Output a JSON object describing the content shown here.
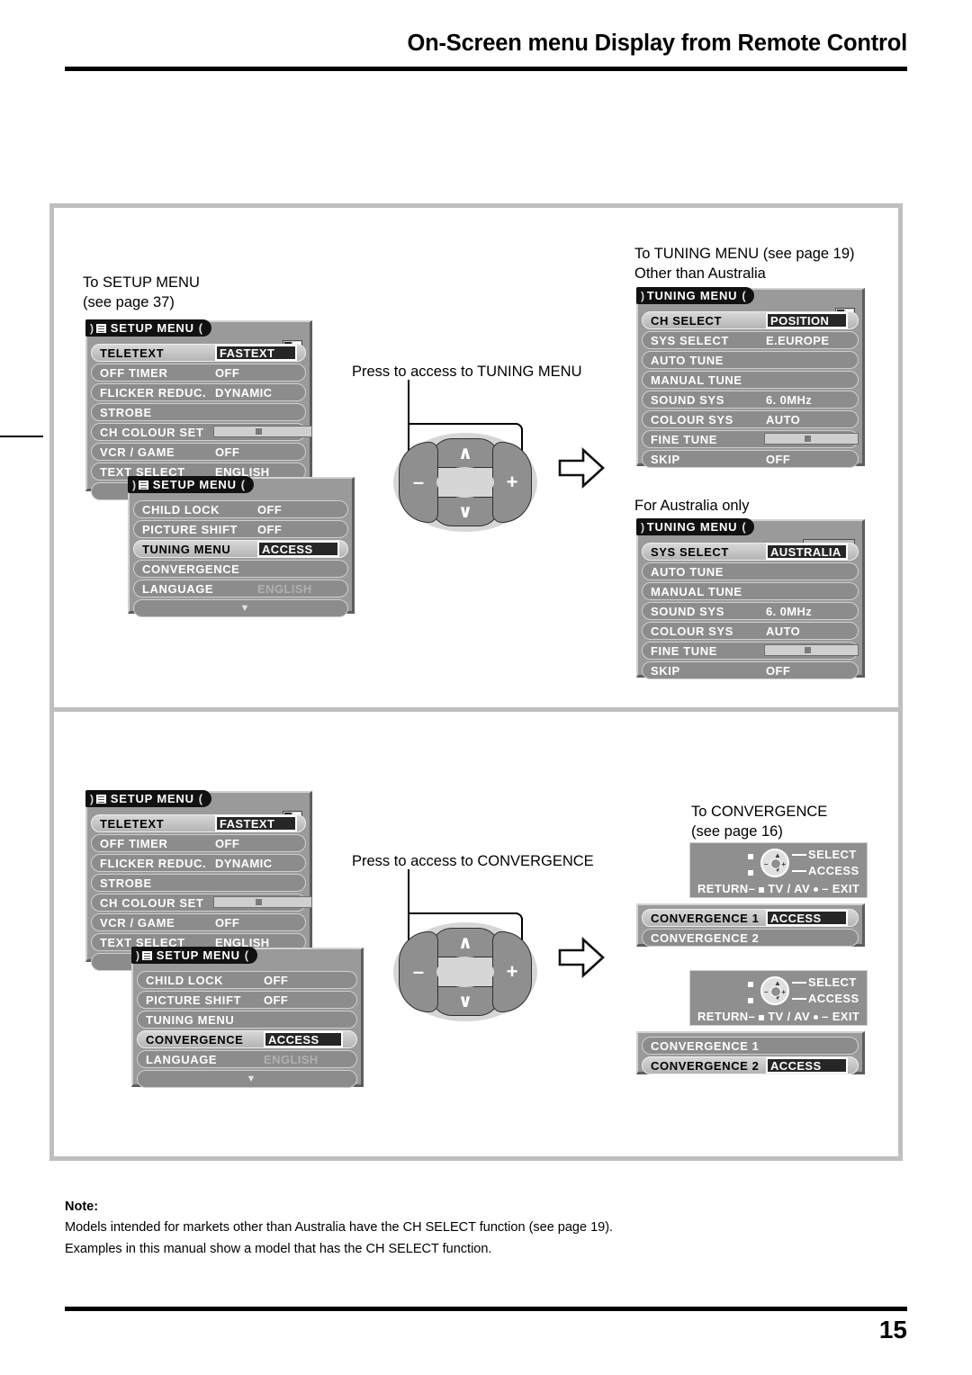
{
  "header": {
    "title": "On-Screen menu Display from Remote Control"
  },
  "footer": {
    "page_number": "15"
  },
  "note": {
    "label": "Note:",
    "line1": "Models intended for markets other than Australia have the CH SELECT function (see page 19).",
    "line2": "Examples in this manual show a model that has the CH SELECT function."
  },
  "captions": {
    "to_setup_menu": "To SETUP MENU\n(see page 37)",
    "press_tuning": "Press to access to TUNING MENU",
    "press_convergence": "Press to access to CONVERGENCE",
    "to_tuning_menu": "To TUNING MENU (see page 19)\nOther than Australia",
    "for_australia_only": "For Australia only",
    "to_convergence": "To CONVERGENCE\n(see page 16)"
  },
  "osd": {
    "setup_menu_title": "SETUP MENU",
    "tuning_menu_title": "TUNING MENU",
    "title_lead": ")",
    "title_tail": "(",
    "down_arrow": "▼"
  },
  "setup_page1": {
    "rows": [
      {
        "label": "TELETEXT",
        "value": "FASTEXT",
        "selected": true,
        "boxed": true
      },
      {
        "label": "OFF TIMER",
        "value": "OFF"
      },
      {
        "label": "FLICKER REDUC.",
        "value": "DYNAMIC"
      },
      {
        "label": "STROBE",
        "value": ""
      },
      {
        "label": "CH COLOUR SET",
        "value": "",
        "slider": true
      },
      {
        "label": "VCR / GAME",
        "value": "OFF"
      },
      {
        "label": "TEXT SELECT",
        "value": "ENGLISH"
      },
      {
        "label": "",
        "value": ""
      }
    ]
  },
  "setup_page2_tuning": {
    "rows": [
      {
        "label": "CHILD LOCK",
        "value": "OFF"
      },
      {
        "label": "PICTURE SHIFT",
        "value": "OFF"
      },
      {
        "label": "TUNING MENU",
        "value": "ACCESS",
        "selected": true,
        "boxed": true
      },
      {
        "label": "CONVERGENCE",
        "value": ""
      },
      {
        "label": "LANGUAGE",
        "value": "ENGLISH",
        "dim": true
      },
      {
        "label": "",
        "value": "",
        "arrow": true
      }
    ]
  },
  "setup_page2_convergence": {
    "rows": [
      {
        "label": "CHILD LOCK",
        "value": "OFF"
      },
      {
        "label": "PICTURE SHIFT",
        "value": "OFF"
      },
      {
        "label": "TUNING MENU",
        "value": ""
      },
      {
        "label": "CONVERGENCE",
        "value": "ACCESS",
        "selected": true,
        "boxed": true
      },
      {
        "label": "LANGUAGE",
        "value": "ENGLISH",
        "dim": true
      },
      {
        "label": "",
        "value": "",
        "arrow": true
      }
    ]
  },
  "tuning_other": {
    "rows": [
      {
        "label": "CH SELECT",
        "value": "POSITION",
        "selected": true,
        "boxed": true
      },
      {
        "label": "SYS SELECT",
        "value": "E.EUROPE"
      },
      {
        "label": "AUTO TUNE",
        "value": ""
      },
      {
        "label": "MANUAL TUNE",
        "value": ""
      },
      {
        "label": "SOUND SYS",
        "value": "6. 0MHz"
      },
      {
        "label": "COLOUR SYS",
        "value": "AUTO"
      },
      {
        "label": "FINE TUNE",
        "value": "",
        "slider": true
      },
      {
        "label": "SKIP",
        "value": "OFF"
      }
    ]
  },
  "tuning_australia": {
    "rows": [
      {
        "label": "SYS SELECT",
        "value": "AUSTRALIA",
        "selected": true,
        "boxed": true
      },
      {
        "label": "AUTO TUNE",
        "value": ""
      },
      {
        "label": "MANUAL TUNE",
        "value": ""
      },
      {
        "label": "SOUND SYS",
        "value": "6. 0MHz"
      },
      {
        "label": "COLOUR SYS",
        "value": "AUTO"
      },
      {
        "label": "FINE TUNE",
        "value": "",
        "slider": true
      },
      {
        "label": "SKIP",
        "value": "OFF"
      }
    ]
  },
  "remote_hint": {
    "select": "SELECT",
    "access": "ACCESS",
    "return": "RETURN",
    "tv_av": "TV / AV",
    "exit": "EXIT",
    "dash": "–"
  },
  "convergence_list_1": {
    "rows": [
      {
        "label": "CONVERGENCE 1",
        "value": "ACCESS",
        "selected": true,
        "boxed": true
      },
      {
        "label": "CONVERGENCE 2",
        "value": ""
      }
    ]
  },
  "convergence_list_2": {
    "rows": [
      {
        "label": "CONVERGENCE 1",
        "value": ""
      },
      {
        "label": "CONVERGENCE 2",
        "value": "ACCESS",
        "selected": true,
        "boxed": true
      }
    ]
  },
  "dpad": {
    "up": "∧",
    "down": "∨",
    "left": "–",
    "right": "+"
  },
  "colors": {
    "frame": "#bfbfbf",
    "osd_bg": "#9a9a9a",
    "row": "#8c8c8c",
    "title": "#111111"
  }
}
